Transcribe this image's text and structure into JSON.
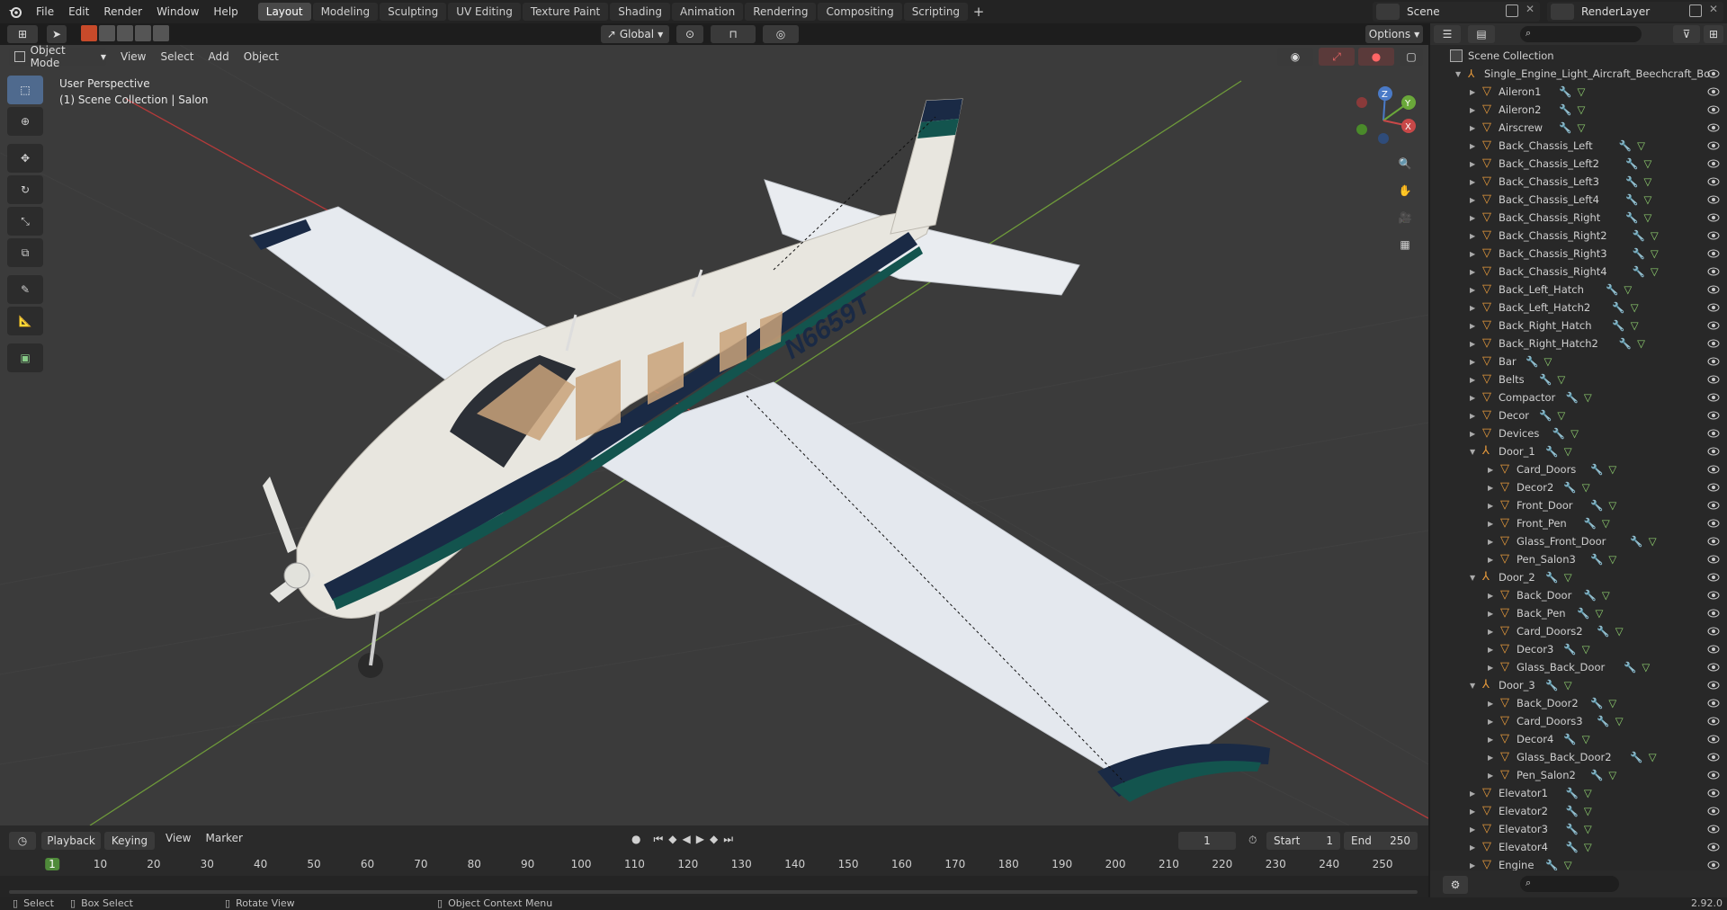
{
  "menu": [
    "File",
    "Edit",
    "Render",
    "Window",
    "Help"
  ],
  "workspaces": [
    "Layout",
    "Modeling",
    "Sculpting",
    "UV Editing",
    "Texture Paint",
    "Shading",
    "Animation",
    "Rendering",
    "Compositing",
    "Scripting"
  ],
  "scene": {
    "scene_name": "Scene",
    "render_layer": "RenderLayer"
  },
  "viewport": {
    "mode": "Object Mode",
    "menus": [
      "View",
      "Select",
      "Add",
      "Object"
    ],
    "transform": "Global",
    "options": "Options",
    "perspective": "User Perspective",
    "collection_info": "(1) Scene Collection | Salon",
    "tail_number": "N6659T"
  },
  "gizmo": {
    "z": "Z",
    "y": "Y",
    "x": "X"
  },
  "outliner": {
    "root": "Scene Collection",
    "object": "Single_Engine_Light_Aircraft_Beechcraft_Bo",
    "items": [
      {
        "name": "Aileron1",
        "depth": 1,
        "type": "mesh"
      },
      {
        "name": "Aileron2",
        "depth": 1,
        "type": "mesh"
      },
      {
        "name": "Airscrew",
        "depth": 1,
        "type": "mesh"
      },
      {
        "name": "Back_Chassis_Left",
        "depth": 1,
        "type": "mesh"
      },
      {
        "name": "Back_Chassis_Left2",
        "depth": 1,
        "type": "mesh"
      },
      {
        "name": "Back_Chassis_Left3",
        "depth": 1,
        "type": "mesh"
      },
      {
        "name": "Back_Chassis_Left4",
        "depth": 1,
        "type": "mesh"
      },
      {
        "name": "Back_Chassis_Right",
        "depth": 1,
        "type": "mesh"
      },
      {
        "name": "Back_Chassis_Right2",
        "depth": 1,
        "type": "mesh"
      },
      {
        "name": "Back_Chassis_Right3",
        "depth": 1,
        "type": "mesh"
      },
      {
        "name": "Back_Chassis_Right4",
        "depth": 1,
        "type": "mesh"
      },
      {
        "name": "Back_Left_Hatch",
        "depth": 1,
        "type": "mesh"
      },
      {
        "name": "Back_Left_Hatch2",
        "depth": 1,
        "type": "mesh"
      },
      {
        "name": "Back_Right_Hatch",
        "depth": 1,
        "type": "mesh"
      },
      {
        "name": "Back_Right_Hatch2",
        "depth": 1,
        "type": "mesh"
      },
      {
        "name": "Bar",
        "depth": 1,
        "type": "mesh"
      },
      {
        "name": "Belts",
        "depth": 1,
        "type": "mesh"
      },
      {
        "name": "Compactor",
        "depth": 1,
        "type": "mesh"
      },
      {
        "name": "Decor",
        "depth": 1,
        "type": "mesh"
      },
      {
        "name": "Devices",
        "depth": 1,
        "type": "mesh"
      },
      {
        "name": "Door_1",
        "depth": 1,
        "type": "empty",
        "open": true
      },
      {
        "name": "Card_Doors",
        "depth": 2,
        "type": "mesh"
      },
      {
        "name": "Decor2",
        "depth": 2,
        "type": "mesh"
      },
      {
        "name": "Front_Door",
        "depth": 2,
        "type": "mesh"
      },
      {
        "name": "Front_Pen",
        "depth": 2,
        "type": "mesh"
      },
      {
        "name": "Glass_Front_Door",
        "depth": 2,
        "type": "mesh"
      },
      {
        "name": "Pen_Salon3",
        "depth": 2,
        "type": "mesh"
      },
      {
        "name": "Door_2",
        "depth": 1,
        "type": "empty",
        "open": true
      },
      {
        "name": "Back_Door",
        "depth": 2,
        "type": "mesh"
      },
      {
        "name": "Back_Pen",
        "depth": 2,
        "type": "mesh"
      },
      {
        "name": "Card_Doors2",
        "depth": 2,
        "type": "mesh"
      },
      {
        "name": "Decor3",
        "depth": 2,
        "type": "mesh"
      },
      {
        "name": "Glass_Back_Door",
        "depth": 2,
        "type": "mesh"
      },
      {
        "name": "Door_3",
        "depth": 1,
        "type": "empty",
        "open": true
      },
      {
        "name": "Back_Door2",
        "depth": 2,
        "type": "mesh"
      },
      {
        "name": "Card_Doors3",
        "depth": 2,
        "type": "mesh"
      },
      {
        "name": "Decor4",
        "depth": 2,
        "type": "mesh"
      },
      {
        "name": "Glass_Back_Door2",
        "depth": 2,
        "type": "mesh"
      },
      {
        "name": "Pen_Salon2",
        "depth": 2,
        "type": "mesh"
      },
      {
        "name": "Elevator1",
        "depth": 1,
        "type": "mesh"
      },
      {
        "name": "Elevator2",
        "depth": 1,
        "type": "mesh"
      },
      {
        "name": "Elevator3",
        "depth": 1,
        "type": "mesh"
      },
      {
        "name": "Elevator4",
        "depth": 1,
        "type": "mesh"
      },
      {
        "name": "Engine",
        "depth": 1,
        "type": "mesh"
      }
    ]
  },
  "timeline": {
    "menus": [
      "Playback",
      "Keying",
      "View",
      "Marker"
    ],
    "current_frame": "1",
    "start_label": "Start",
    "start": "1",
    "end_label": "End",
    "end": "250",
    "ticks": [
      "1",
      "10",
      "20",
      "30",
      "40",
      "50",
      "60",
      "70",
      "80",
      "90",
      "100",
      "110",
      "120",
      "130",
      "140",
      "150",
      "160",
      "170",
      "180",
      "190",
      "200",
      "210",
      "220",
      "230",
      "240",
      "250"
    ]
  },
  "status": {
    "select": "Select",
    "box_select": "Box Select",
    "rotate": "Rotate View",
    "context": "Object Context Menu",
    "version": "2.92.0"
  },
  "colors": {
    "accent": "#4f6a8e",
    "mesh_icon": "#e79a3c",
    "green_axis": "#6e9a3a",
    "red_axis": "#b53a3a"
  }
}
